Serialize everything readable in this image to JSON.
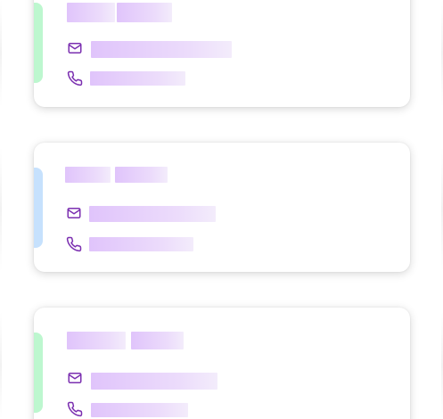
{
  "contacts": [
    {
      "accent": "green",
      "icons": {
        "email": "mail-icon",
        "phone": "phone-icon"
      }
    },
    {
      "accent": "blue",
      "icons": {
        "email": "mail-icon",
        "phone": "phone-icon"
      }
    },
    {
      "accent": "green",
      "icons": {
        "email": "mail-icon",
        "phone": "phone-icon"
      }
    }
  ],
  "colors": {
    "icon_stroke": "#7b2fb0",
    "placeholder_start": "#e0c4fb",
    "placeholder_end": "#f3ecfb",
    "accent_green": "#bdf7cf",
    "accent_blue": "#c6e1fd"
  }
}
